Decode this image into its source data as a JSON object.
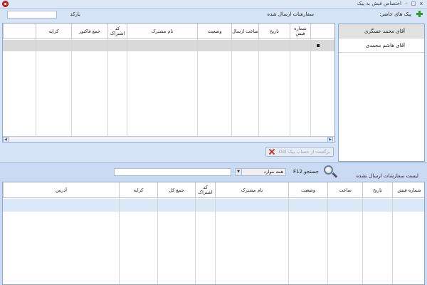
{
  "window": {
    "title": "اختصاص فیش به پیک",
    "close_glyph": "x",
    "minimize_glyph": "–",
    "restore_glyph": "□"
  },
  "top": {
    "couriers_label": "پیک های حاضر:",
    "sent_orders_label": "سفارشات ارسال شده",
    "barcode_label": "بارکد",
    "barcode_value": "",
    "couriers": [
      {
        "name": "آقای محمد عسگری",
        "selected": true
      },
      {
        "name": "آقای هاشم محمدی",
        "selected": false
      }
    ],
    "sent_grid": {
      "columns": [
        "شماره فیش",
        "تاریخ",
        "ساعت ارسال",
        "وضعیت",
        "نام مشترک",
        "کد اشتراک",
        "جمع فاکتور",
        "کرایه"
      ]
    },
    "return_button_label": "برگشت از حساب پیک Del"
  },
  "bottom": {
    "unsent_orders_label": "لیست سفارشات ارسال نشده",
    "search_label": "جستجو F12",
    "filter_value": "همه موارد",
    "search_value": "",
    "unsent_grid": {
      "columns": [
        "شماره فیش",
        "تاریخ",
        "ساعت",
        "وضعیت",
        "نام مشترک",
        "کد اشتراک",
        "جمع کل",
        "کرایه",
        "آدرس"
      ]
    }
  }
}
